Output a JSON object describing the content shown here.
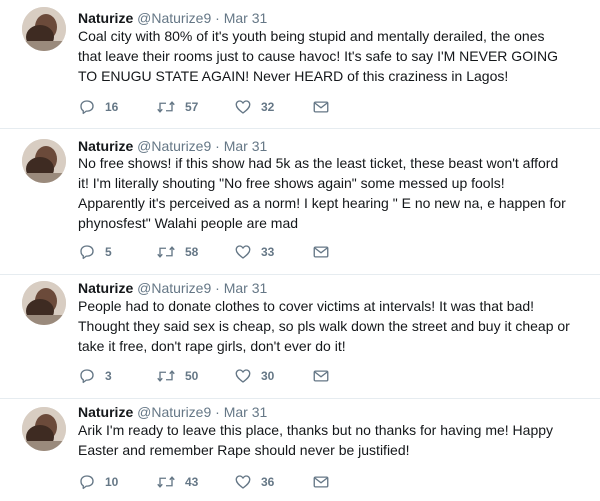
{
  "tweets": [
    {
      "name": "Naturize",
      "handle": "@Naturize9",
      "sep": "·",
      "time": "Mar 31",
      "lines": [
        "Coal city with 80% of it's youth being stupid and mentally derailed, the ones",
        "that leave their rooms just to cause havoc! It's safe to say I'M NEVER GOING",
        "TO ENUGU STATE AGAIN! Never HEARD of this craziness in Lagos!"
      ],
      "replies": "16",
      "retweets": "57",
      "likes": "32"
    },
    {
      "name": "Naturize",
      "handle": "@Naturize9",
      "sep": "·",
      "time": "Mar 31",
      "lines": [
        "No free shows!  if this show had 5k as the least ticket, these beast won't afford",
        "it! I'm literally shouting \"No free shows again\" some messed up fools!",
        "Apparently it's perceived as a norm! I kept hearing \" E no new na, e happen for",
        "phynosfest\" Walahi people are mad"
      ],
      "replies": "5",
      "retweets": "58",
      "likes": "33"
    },
    {
      "name": "Naturize",
      "handle": "@Naturize9",
      "sep": "·",
      "time": "Mar 31",
      "lines": [
        "People had to donate clothes to cover victims at intervals! It was that bad!",
        "Thought they said sex is cheap, so pls walk down the street and buy it cheap or",
        "take it free, don't rape girls, don't ever do it!"
      ],
      "replies": "3",
      "retweets": "50",
      "likes": "30"
    },
    {
      "name": "Naturize",
      "handle": "@Naturize9",
      "sep": "·",
      "time": "Mar 31",
      "lines": [
        "Arik I'm ready to leave this place, thanks but no thanks for having me! Happy",
        "Easter and remember Rape should never be justified!"
      ],
      "replies": "10",
      "retweets": "43",
      "likes": "36"
    }
  ],
  "icons": {
    "reply": "reply-icon",
    "retweet": "retweet-icon",
    "like": "heart-icon",
    "message": "envelope-icon"
  },
  "colors": {
    "text": "#14171a",
    "secondary": "#657786",
    "divider": "#e6ecf0"
  }
}
